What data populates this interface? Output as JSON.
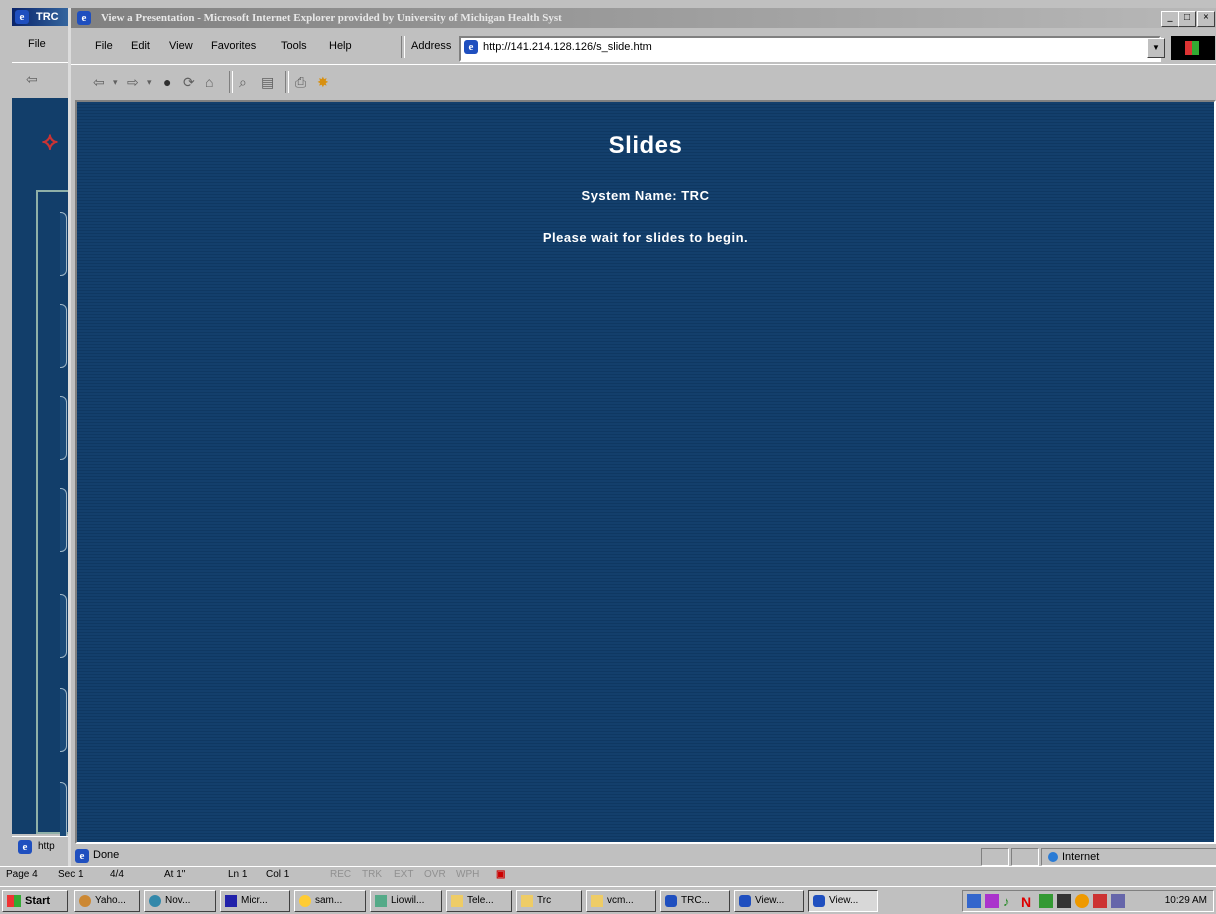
{
  "background_window": {
    "title": "TRC",
    "menu_first": "File",
    "status_text": "http"
  },
  "window": {
    "title": "View a Presentation - Microsoft Internet Explorer provided by University of Michigan Health Syst",
    "buttons": {
      "minimize": "_",
      "maximize": "□",
      "close": "×"
    }
  },
  "menu": {
    "items": [
      "File",
      "Edit",
      "View",
      "Favorites",
      "Tools",
      "Help"
    ]
  },
  "address": {
    "label": "Address",
    "url": "http://141.214.128.126/s_slide.htm"
  },
  "toolbar": {
    "icons": [
      "back-icon",
      "forward-icon",
      "stop-icon",
      "refresh-icon",
      "home-icon",
      "search-icon",
      "favorites-icon",
      "print-icon",
      "messenger-icon"
    ]
  },
  "page": {
    "title": "Slides",
    "system_name": "System Name: TRC",
    "message": "Please wait for slides to begin.",
    "background_color": "#133f6c"
  },
  "status": {
    "text": "Done",
    "zone": "Internet"
  },
  "word_status": {
    "page": "Page 4",
    "sec": "Sec 1",
    "pages": "4/4",
    "at": "At 1\"",
    "ln": "Ln 1",
    "col": "Col 1",
    "modes": [
      "REC",
      "TRK",
      "EXT",
      "OVR",
      "WPH"
    ]
  },
  "taskbar": {
    "start": "Start",
    "tasks": [
      "Yaho...",
      "Nov...",
      "Micr...",
      "sam...",
      "Liowil...",
      "Tele...",
      "Trc",
      "vcm...",
      "TRC...",
      "View...",
      "View..."
    ],
    "clock": "10:29 AM"
  }
}
